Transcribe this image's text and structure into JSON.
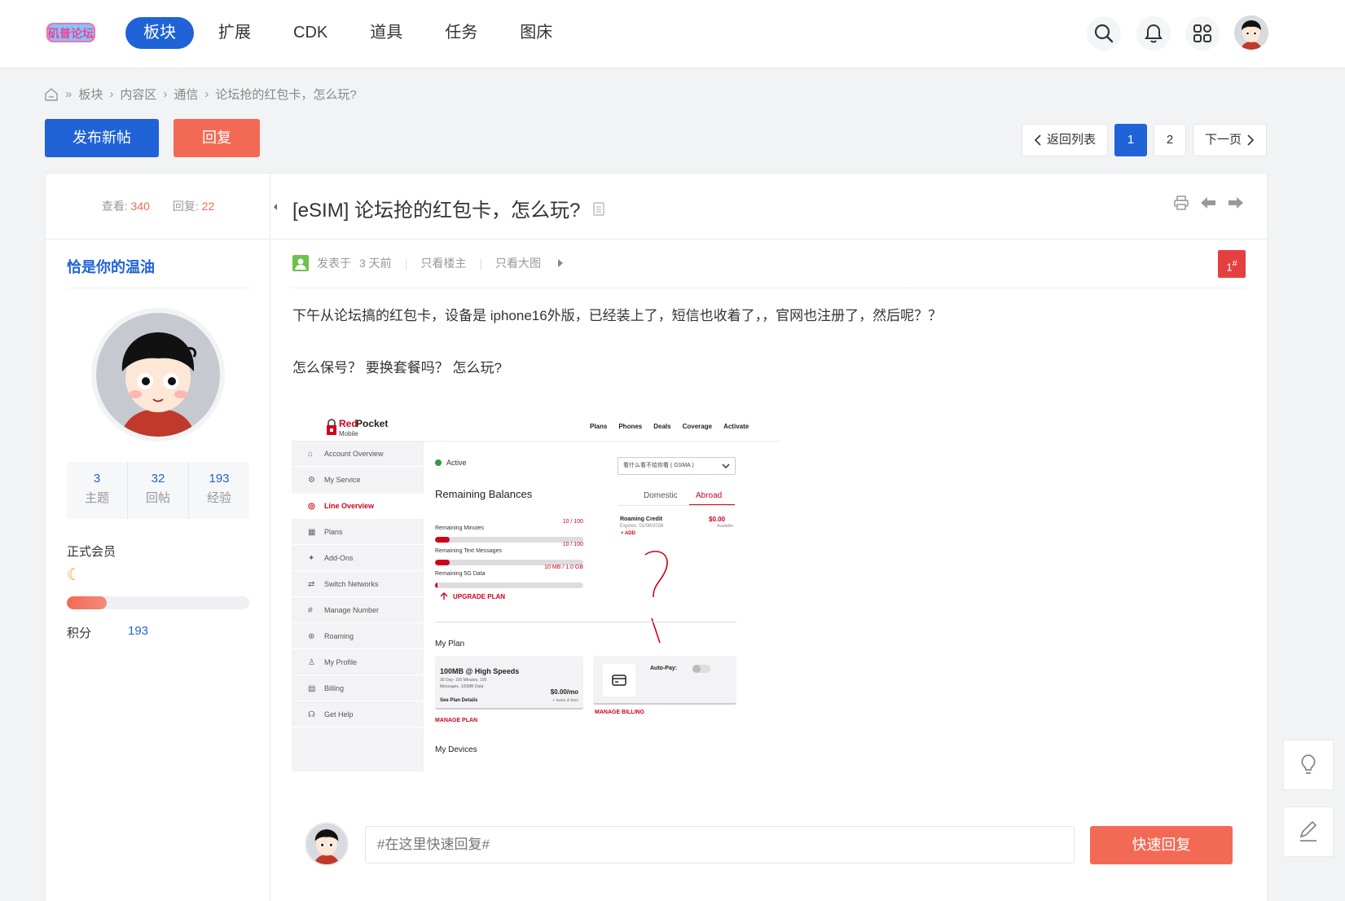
{
  "header": {
    "logo_text": "矶普论坛",
    "nav": [
      {
        "label": "板块",
        "active": true
      },
      {
        "label": "扩展"
      },
      {
        "label": "CDK"
      },
      {
        "label": "道具"
      },
      {
        "label": "任务"
      },
      {
        "label": "图床"
      }
    ]
  },
  "breadcrumb": {
    "sep_first": "»",
    "sep": "›",
    "items": [
      "板块",
      "内容区",
      "通信",
      "论坛抢的红包卡，怎么玩?"
    ]
  },
  "actions": {
    "new_post": "发布新帖",
    "reply": "回复"
  },
  "pager": {
    "back": "返回列表",
    "pages": [
      "1",
      "2"
    ],
    "current": "1",
    "next": "下一页"
  },
  "sidebar": {
    "views_label": "查看:",
    "views": "340",
    "replies_label": "回复:",
    "replies": "22",
    "username": "恰是你的温油",
    "stats": [
      {
        "value": "3",
        "label": "主题"
      },
      {
        "value": "32",
        "label": "回帖"
      },
      {
        "value": "193",
        "label": "经验"
      }
    ],
    "member_group": "正式会员",
    "level_progress": 0.22,
    "score_label": "积分",
    "score": "193"
  },
  "post": {
    "title": "[eSIM] 论坛抢的红包卡，怎么玩?",
    "posted_prefix": "发表于",
    "posted_time": "3 天前",
    "only_op": "只看楼主",
    "only_images": "只看大图",
    "floor_num": "1",
    "floor_sup": "#",
    "body_line1": "下午从论坛搞的红包卡，设备是 iphone16外版，已经装上了，短信也收着了，，官网也注册了，然后呢？？",
    "body_line2": "怎么保号？  要换套餐吗？  怎么玩?"
  },
  "embedded": {
    "brand_red": "Red",
    "brand_pocket": "Pocket",
    "brand_sub": "Mobile",
    "topnav": [
      "Plans",
      "Phones",
      "Deals",
      "Coverage",
      "Activate"
    ],
    "side_items": [
      {
        "icon": "⌂",
        "label": "Account Overview"
      },
      {
        "icon": "⚙",
        "label": "My Service"
      },
      {
        "icon": "◎",
        "label": "Line Overview",
        "active": true
      },
      {
        "icon": "▦",
        "label": "Plans"
      },
      {
        "icon": "✦",
        "label": "Add-Ons"
      },
      {
        "icon": "⇄",
        "label": "Switch Networks"
      },
      {
        "icon": "#",
        "label": "Manage Number"
      },
      {
        "icon": "⊕",
        "label": "Roaming"
      },
      {
        "icon": "♙",
        "label": "My Profile"
      },
      {
        "icon": "▤",
        "label": "Billing"
      },
      {
        "icon": "☊",
        "label": "Get Help"
      }
    ],
    "status": "Active",
    "number_select": "看什么看不给你看 ( GSMA )",
    "remaining_title": "Remaining Balances",
    "tabs": [
      "Domestic",
      "Abroad"
    ],
    "balances": [
      {
        "label": "Remaining Minutes",
        "value": "10 / 100",
        "fill": 0.1
      },
      {
        "label": "Remaining Text Messages",
        "value": "10 / 100",
        "fill": 0.1
      },
      {
        "label": "Remaining 5G Data",
        "value": "10 MB / 1.0 GB",
        "fill": 0.01
      }
    ],
    "roaming_title": "Roaming Credit",
    "roaming_expires": "Expires: 01/08/2026",
    "roaming_value": "$0.00",
    "roaming_avail": "Available",
    "roaming_add": "+ ADD",
    "upgrade": "UPGRADE PLAN",
    "my_plan_title": "My Plan",
    "plan_name": "100MB @ High Speeds",
    "plan_desc1": "30 Day- 100 Minutes, 100",
    "plan_desc2": "Messages, 100MB Data",
    "plan_details": "See Plan Details",
    "plan_price": "$0.00/mo",
    "plan_taxes": "+ taxes & fees",
    "manage_plan": "MANAGE PLAN",
    "autopay": "Auto-Pay:",
    "manage_billing": "MANAGE BILLING",
    "devices_title": "My Devices"
  },
  "quick_reply": {
    "placeholder": "#在这里快速回复#",
    "button": "快速回复"
  },
  "colors": {
    "primary": "#1f63d6",
    "accent": "#f26a55",
    "floor": "#e34040",
    "brand_red": "#d0021b"
  }
}
